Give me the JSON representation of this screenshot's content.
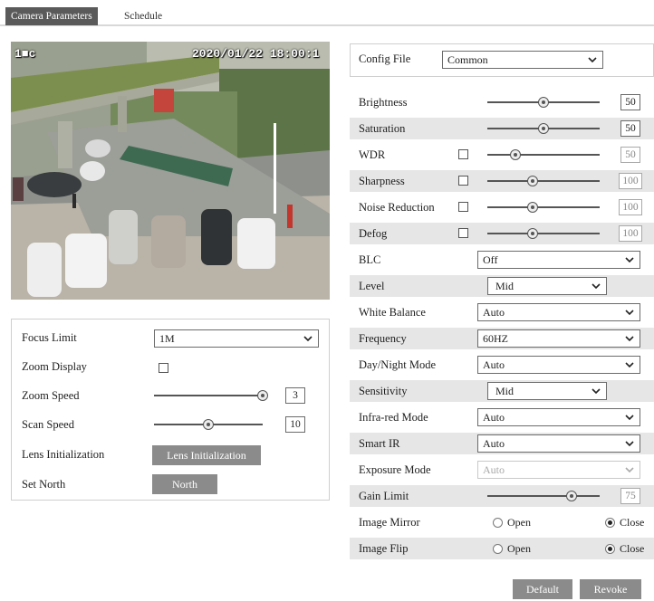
{
  "tabs": [
    {
      "label": "Camera Parameters",
      "active": true
    },
    {
      "label": "Schedule",
      "active": false
    }
  ],
  "video": {
    "osd_left": "1■c",
    "osd_datetime": "2020/01/22 18:00:1"
  },
  "lens_panel": {
    "focus_limit": {
      "label": "Focus Limit",
      "value": "1M"
    },
    "zoom_display": {
      "label": "Zoom Display",
      "checked": false
    },
    "zoom_speed": {
      "label": "Zoom Speed",
      "value": "3",
      "level": 1.0
    },
    "scan_speed": {
      "label": "Scan Speed",
      "value": "10",
      "level": 0.5
    },
    "lens_init": {
      "label": "Lens Initialization",
      "button": "Lens Initialization"
    },
    "set_north": {
      "label": "Set North",
      "button": "North"
    }
  },
  "config_file": {
    "label": "Config File",
    "value": "Common"
  },
  "params": {
    "brightness": {
      "label": "Brightness",
      "value": "50",
      "level": 0.5
    },
    "saturation": {
      "label": "Saturation",
      "value": "50",
      "level": 0.5
    },
    "wdr": {
      "label": "WDR",
      "value": "50",
      "level": 0.25,
      "enabled": false
    },
    "sharpness": {
      "label": "Sharpness",
      "value": "100",
      "level": 0.4,
      "enabled": false
    },
    "noise_reduction": {
      "label": "Noise Reduction",
      "value": "100",
      "level": 0.4,
      "enabled": false
    },
    "defog": {
      "label": "Defog",
      "value": "100",
      "level": 0.4,
      "enabled": false
    },
    "blc": {
      "label": "BLC",
      "value": "Off"
    },
    "level": {
      "label": "Level",
      "value": "Mid"
    },
    "white_balance": {
      "label": "White Balance",
      "value": "Auto"
    },
    "frequency": {
      "label": "Frequency",
      "value": "60HZ"
    },
    "day_night": {
      "label": "Day/Night Mode",
      "value": "Auto"
    },
    "sensitivity": {
      "label": "Sensitivity",
      "value": "Mid"
    },
    "infrared": {
      "label": "Infra-red Mode",
      "value": "Auto"
    },
    "smart_ir": {
      "label": "Smart IR",
      "value": "Auto"
    },
    "exposure": {
      "label": "Exposure Mode",
      "value": "Auto"
    },
    "gain_limit": {
      "label": "Gain Limit",
      "value": "75",
      "level": 0.75
    },
    "image_mirror": {
      "label": "Image Mirror",
      "open": "Open",
      "close": "Close",
      "selected": "Close"
    },
    "image_flip": {
      "label": "Image Flip",
      "open": "Open",
      "close": "Close",
      "selected": "Close"
    }
  },
  "actions": {
    "default": "Default",
    "revoke": "Revoke"
  },
  "colors": {
    "tab_active": "#5a5a5a",
    "button": "#8b8b8b",
    "row_shade": "#e6e6e6"
  }
}
